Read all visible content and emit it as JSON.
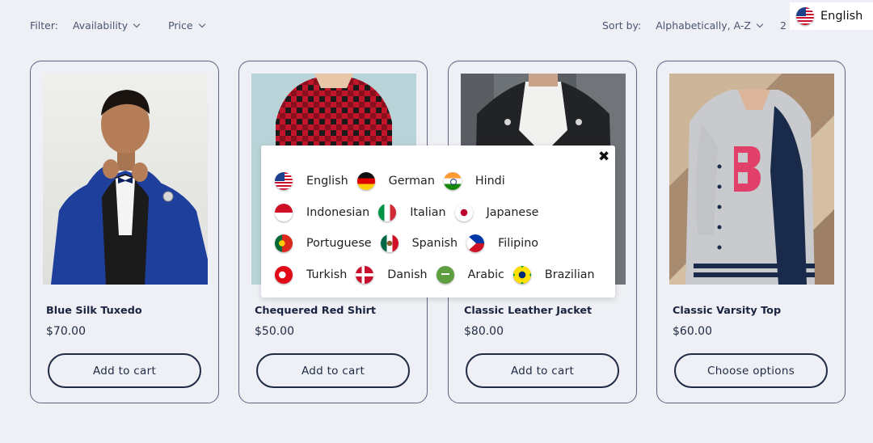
{
  "filter": {
    "label": "Filter:",
    "options": [
      "Availability",
      "Price"
    ]
  },
  "sort": {
    "label": "Sort by:",
    "value": "Alphabetically, A-Z",
    "count_partial": "2"
  },
  "language_button": {
    "label": "English",
    "flag": "us-flag-icon"
  },
  "products": [
    {
      "title": "Blue Silk Tuxedo",
      "price": "$70.00",
      "button": "Add to cart"
    },
    {
      "title": "Chequered Red Shirt",
      "price": "$50.00",
      "button": "Add to cart"
    },
    {
      "title": "Classic Leather Jacket",
      "price": "$80.00",
      "button": "Add to cart"
    },
    {
      "title": "Classic Varsity Top",
      "price": "$60.00",
      "button": "Choose options"
    }
  ],
  "language_popup": {
    "close": "✖",
    "rows": [
      [
        {
          "name": "English",
          "flag": "us-flag-icon"
        },
        {
          "name": "German",
          "flag": "de-flag-icon"
        },
        {
          "name": "Hindi",
          "flag": "in-flag-icon"
        }
      ],
      [
        {
          "name": "Indonesian",
          "flag": "id-flag-icon"
        },
        {
          "name": "Italian",
          "flag": "it-flag-icon"
        },
        {
          "name": "Japanese",
          "flag": "jp-flag-icon"
        }
      ],
      [
        {
          "name": "Portuguese",
          "flag": "pt-flag-icon"
        },
        {
          "name": "Spanish",
          "flag": "mx-flag-icon"
        },
        {
          "name": "Filipino",
          "flag": "ph-flag-icon"
        }
      ],
      [
        {
          "name": "Turkish",
          "flag": "tr-flag-icon"
        },
        {
          "name": "Danish",
          "flag": "dk-flag-icon"
        },
        {
          "name": "Arabic",
          "flag": "sa-flag-icon"
        },
        {
          "name": "Brazilian",
          "flag": "br-flag-icon"
        }
      ]
    ]
  },
  "colors": {
    "background": "#eef0f5",
    "text": "#1f2a44",
    "border": "#5a6482"
  }
}
